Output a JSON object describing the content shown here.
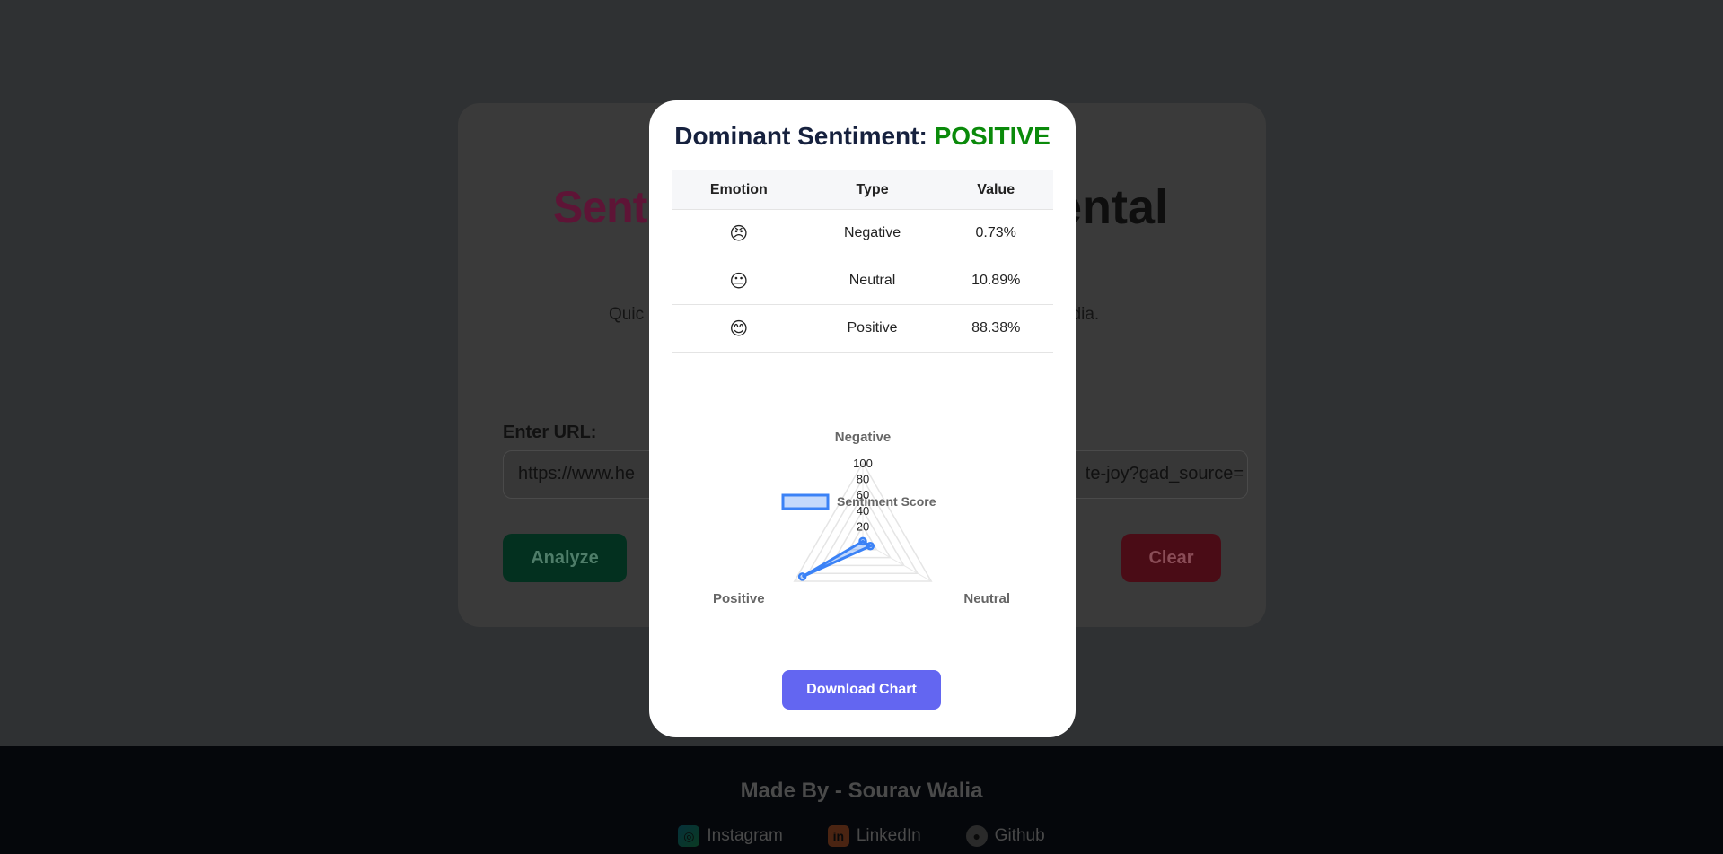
{
  "background": {
    "title_left": "Sent",
    "title_right": "ental",
    "subtitle_left": "Quic",
    "subtitle_right": "edia.",
    "url_label": "Enter URL:",
    "url_value_left": "https://www.he",
    "url_value_right": "te-joy?gad_source=",
    "analyze_label": "Analyze",
    "clear_label": "Clear"
  },
  "footer": {
    "made_by": "Made By - Sourav Walia",
    "links": [
      {
        "label": "Instagram",
        "icon": "instagram-icon"
      },
      {
        "label": "LinkedIn",
        "icon": "linkedin-icon"
      },
      {
        "label": "Github",
        "icon": "github-icon"
      }
    ]
  },
  "modal": {
    "title_prefix": "Dominant Sentiment: ",
    "dominant": "POSITIVE",
    "dominant_color": "#0a8a0a",
    "table": {
      "headers": [
        "Emotion",
        "Type",
        "Value"
      ],
      "rows": [
        {
          "emoji": "😠",
          "type": "Negative",
          "value": "0.73%"
        },
        {
          "emoji": "😐",
          "type": "Neutral",
          "value": "10.89%"
        },
        {
          "emoji": "😊",
          "type": "Positive",
          "value": "88.38%"
        }
      ]
    },
    "download_label": "Download Chart"
  },
  "chart_data": {
    "type": "radar",
    "legend": "Sentiment Score",
    "legend_position": "top",
    "categories": [
      "Negative",
      "Neutral",
      "Positive"
    ],
    "values": [
      0.73,
      10.89,
      88.38
    ],
    "r_ticks": [
      "20",
      "40",
      "60",
      "80",
      "100"
    ],
    "rlim": [
      0,
      100
    ],
    "color": "#3b82f6"
  }
}
